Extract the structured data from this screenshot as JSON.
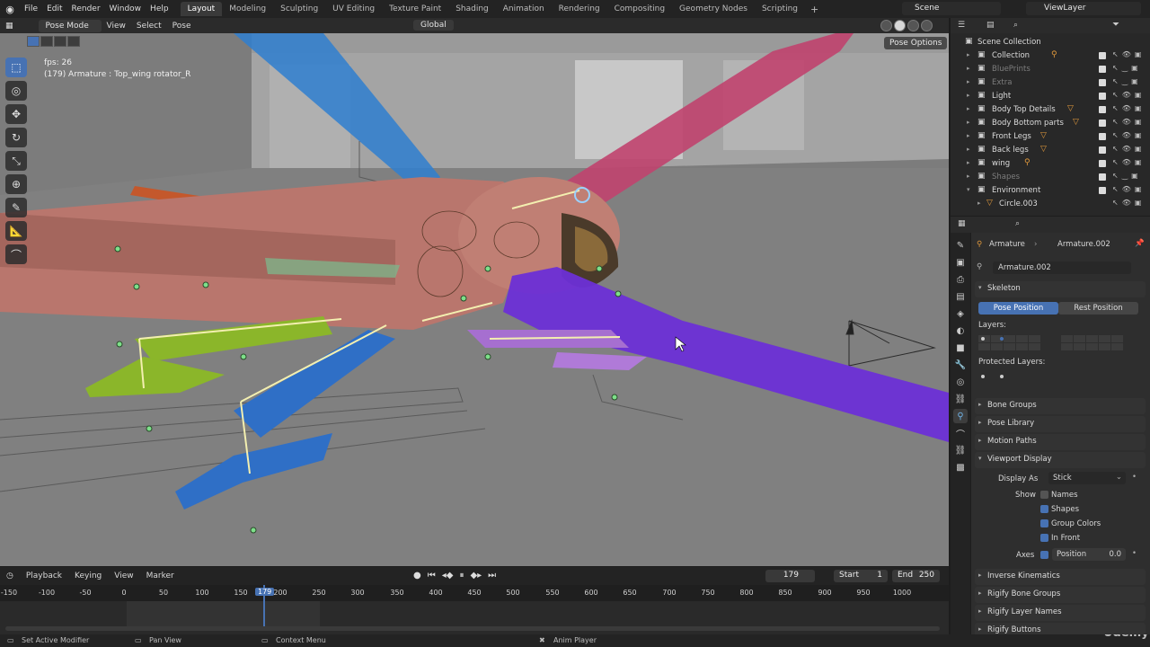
{
  "menu": [
    "File",
    "Edit",
    "Render",
    "Window",
    "Help"
  ],
  "workspaces": [
    "Layout",
    "Modeling",
    "Sculpting",
    "UV Editing",
    "Texture Paint",
    "Shading",
    "Animation",
    "Rendering",
    "Compositing",
    "Geometry Nodes",
    "Scripting"
  ],
  "active_workspace": "Layout",
  "scene": "Scene",
  "view_layer": "ViewLayer",
  "viewport_header": {
    "mode": "Pose Mode",
    "items": [
      "View",
      "Select",
      "Pose"
    ],
    "orientation": "Global",
    "pose_options": "Pose Options"
  },
  "overlay": {
    "fps": "fps: 26",
    "info": "(179) Armature : Top_wing rotator_R"
  },
  "timeline": {
    "menus": [
      "Playback",
      "Keying",
      "View",
      "Marker"
    ],
    "current_frame": "179",
    "start_label": "Start",
    "start": "1",
    "end_label": "End",
    "end": "250",
    "ticks": [
      "-150",
      "-100",
      "-50",
      "0",
      "50",
      "100",
      "150",
      "200",
      "250",
      "300",
      "350",
      "400",
      "450",
      "500",
      "550",
      "600",
      "650",
      "700",
      "750",
      "800",
      "850",
      "900",
      "950",
      "1000"
    ],
    "cursor_label": "179"
  },
  "status_bar": {
    "left": "Set Active Modifier",
    "middle": "Pan View",
    "right": "Context Menu",
    "center": "Anim Player"
  },
  "outliner": {
    "root": "Scene Collection",
    "rows": [
      {
        "name": "Collection",
        "dim": false
      },
      {
        "name": "BluePrints",
        "dim": true
      },
      {
        "name": "Extra",
        "dim": true
      },
      {
        "name": "Light",
        "dim": false
      },
      {
        "name": "Body Top Details",
        "dim": false
      },
      {
        "name": "Body Bottom parts",
        "dim": false
      },
      {
        "name": "Front Legs",
        "dim": false
      },
      {
        "name": "Back legs",
        "dim": false
      },
      {
        "name": "wing",
        "dim": false
      },
      {
        "name": "Shapes",
        "dim": true
      },
      {
        "name": "Environment",
        "dim": false
      },
      {
        "name": "Circle.003",
        "dim": false
      }
    ]
  },
  "properties": {
    "breadcrumb_object": "Armature",
    "breadcrumb_data": "Armature.002",
    "data_name": "Armature.002",
    "skeleton": "Skeleton",
    "pose_position": "Pose Position",
    "rest_position": "Rest Position",
    "layers": "Layers:",
    "protected_layers": "Protected Layers:",
    "panels_collapsed": [
      "Bone Groups",
      "Pose Library",
      "Motion Paths"
    ],
    "viewport_display": "Viewport Display",
    "display_as_label": "Display As",
    "display_as": "Stick",
    "show_label": "Show",
    "show_names": "Names",
    "show_shapes": "Shapes",
    "show_group_colors": "Group Colors",
    "show_in_front": "In Front",
    "axes_label": "Axes",
    "axes_position": "Position",
    "axes_value": "0.0",
    "panels_bottom": [
      "Inverse Kinematics",
      "Rigify Bone Groups",
      "Rigify Layer Names",
      "Rigify Buttons"
    ]
  },
  "watermark": "Udemy",
  "colors": {
    "accent": "#4772b3",
    "wing_blue": "#2f7fd0",
    "wing_pink": "#c0436e",
    "wing_purple": "#6c2fd6",
    "body": "#b8736a",
    "legs_green": "#8bb62a",
    "legs_blue": "#2f6fc6",
    "legs_violet": "#a66fd0"
  }
}
